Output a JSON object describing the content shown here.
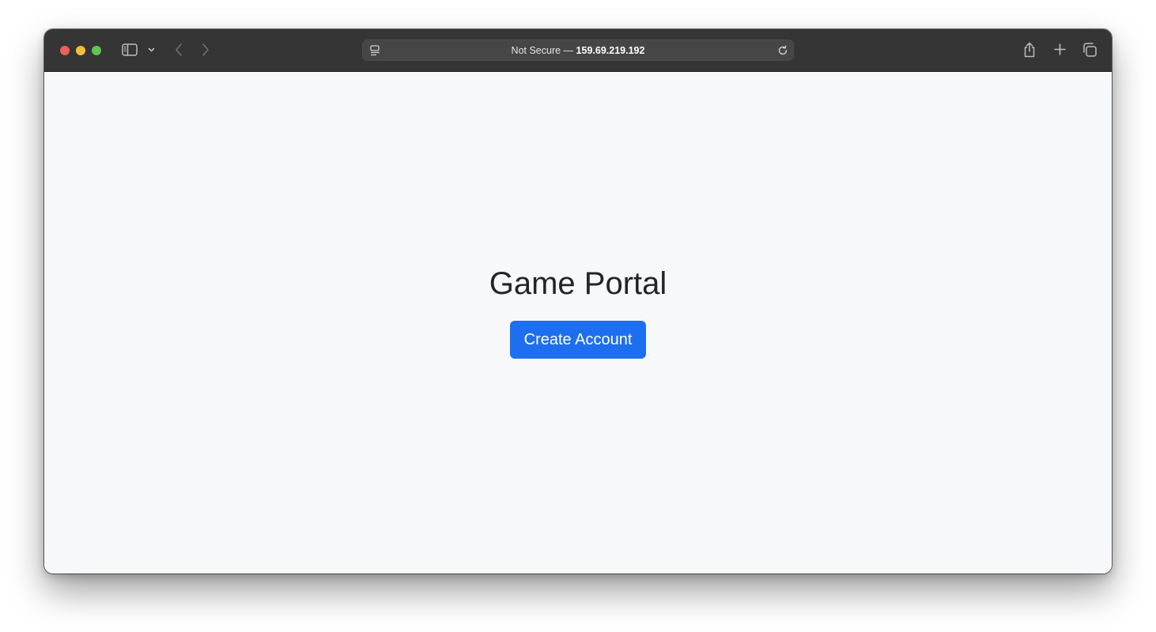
{
  "browser": {
    "address": {
      "security_label": "Not Secure —",
      "host": "159.69.219.192"
    },
    "icons": {
      "sidebar": "sidebar-icon",
      "sidebar_menu": "chevron-down-icon",
      "back": "chevron-left-icon",
      "forward": "chevron-right-icon",
      "site_info": "page-info-icon",
      "reload": "reload-icon",
      "share": "share-icon",
      "new_tab": "plus-icon",
      "tab_overview": "tabs-overview-icon"
    },
    "traffic_lights": {
      "close": "#ed5f57",
      "minimize": "#f4bd3b",
      "maximize": "#5fc553"
    }
  },
  "page": {
    "title": "Game Portal",
    "create_account_label": "Create Account",
    "background": "#f7f8fa",
    "accent": "#1d6ff0"
  }
}
